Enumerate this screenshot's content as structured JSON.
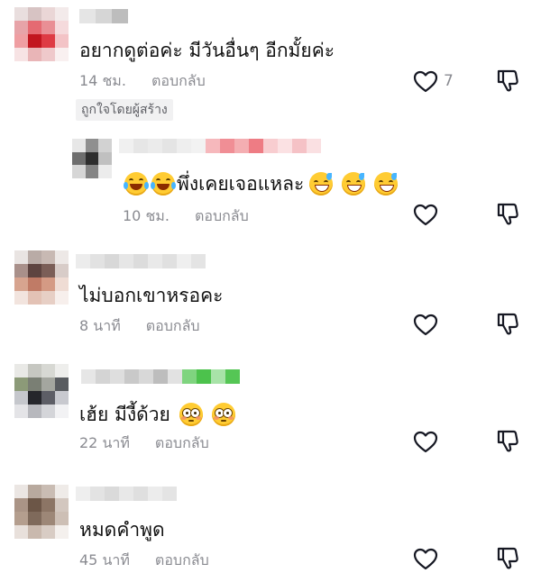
{
  "comments": [
    {
      "text": "อยากดูต่อค่ะ มีวันอื่นๆ อีกมั้ยค่ะ",
      "time": "14 ชม.",
      "reply_label": "ตอบกลับ",
      "like_count": "7",
      "creator_liked_label": "ถูกใจโดยผู้สร้าง"
    },
    {
      "text": "พึ่งเคยเจอแหละ",
      "time": "10 ชม.",
      "reply_label": "ตอบกลับ"
    },
    {
      "text": "ไม่บอกเขาหรอคะ",
      "time": "8 นาที",
      "reply_label": "ตอบกลับ"
    },
    {
      "text": "เฮ้ย มีงี้ด้วย",
      "time": "22 นาที",
      "reply_label": "ตอบกลับ"
    },
    {
      "text": "หมดคำพูด",
      "time": "45 นาที",
      "reply_label": "ตอบกลับ"
    }
  ],
  "icons": {
    "like": "heart-outline-icon",
    "dislike": "thumbs-down-outline-icon"
  },
  "colors": {
    "meta_text": "#8a8b91",
    "tag_background": "#f1f1f2",
    "icon_stroke": "#161823"
  }
}
